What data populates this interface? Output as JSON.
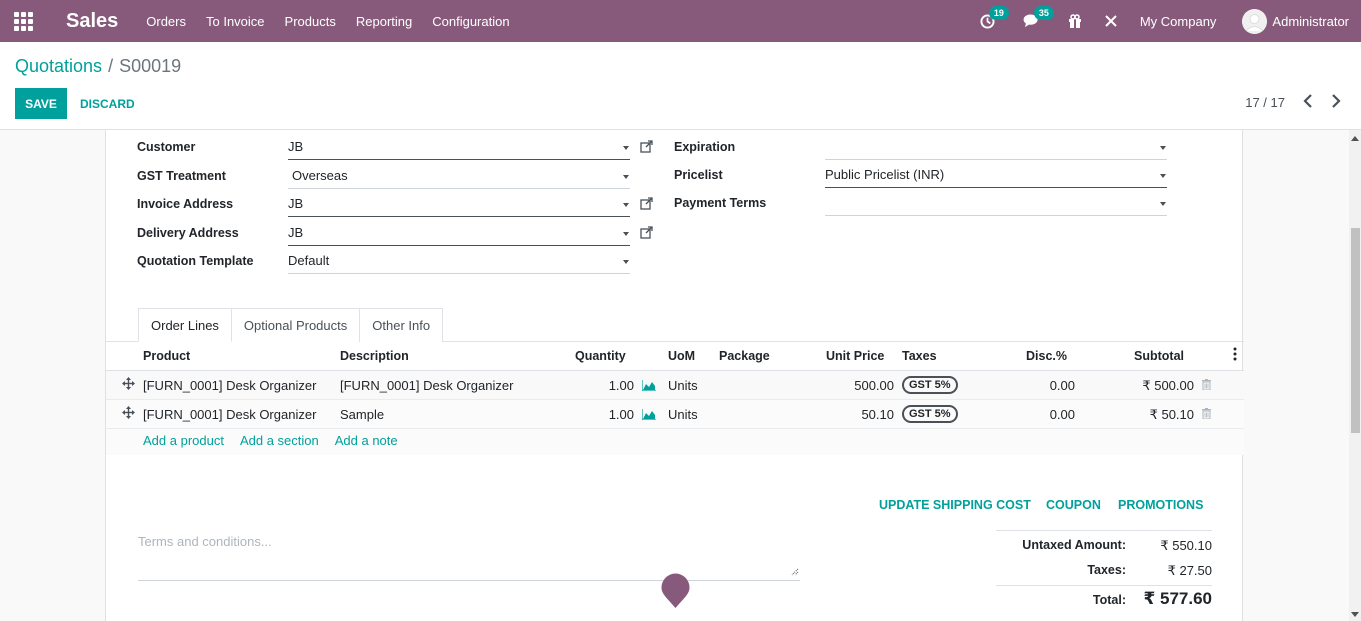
{
  "navbar": {
    "app_name": "Sales",
    "menu": [
      "Orders",
      "To Invoice",
      "Products",
      "Reporting",
      "Configuration"
    ],
    "activity_count": "19",
    "message_count": "35",
    "company": "My Company",
    "user": "Administrator"
  },
  "breadcrumb": {
    "parent": "Quotations",
    "separator": "/",
    "current": "S00019"
  },
  "actions": {
    "save": "SAVE",
    "discard": "DISCARD"
  },
  "pager": {
    "value": "17 / 17"
  },
  "form": {
    "customer_label": "Customer",
    "customer_value": "JB",
    "gst_label": "GST Treatment",
    "gst_value": "Overseas",
    "invoice_address_label": "Invoice Address",
    "invoice_address_value": "JB",
    "delivery_address_label": "Delivery Address",
    "delivery_address_value": "JB",
    "template_label": "Quotation Template",
    "template_value": "Default",
    "expiration_label": "Expiration",
    "expiration_value": "",
    "pricelist_label": "Pricelist",
    "pricelist_value": "Public Pricelist (INR)",
    "payment_terms_label": "Payment Terms",
    "payment_terms_value": ""
  },
  "tabs": [
    "Order Lines",
    "Optional Products",
    "Other Info"
  ],
  "table": {
    "headers": [
      "Product",
      "Description",
      "Quantity",
      "UoM",
      "Package",
      "Unit Price",
      "Taxes",
      "Disc.%",
      "Subtotal"
    ],
    "rows": [
      {
        "product": "[FURN_0001] Desk Organizer",
        "description": "[FURN_0001] Desk Organizer",
        "quantity": "1.00",
        "uom": "Units",
        "package": "",
        "unit_price": "500.00",
        "taxes": "GST 5%",
        "discount": "0.00",
        "subtotal": "₹ 500.00"
      },
      {
        "product": "[FURN_0001] Desk Organizer",
        "description": "Sample",
        "quantity": "1.00",
        "uom": "Units",
        "package": "",
        "unit_price": "50.10",
        "taxes": "GST 5%",
        "discount": "0.00",
        "subtotal": "₹ 50.10"
      }
    ],
    "add_links": [
      "Add a product",
      "Add a section",
      "Add a note"
    ]
  },
  "bottom_actions": [
    "UPDATE SHIPPING COST",
    "COUPON",
    "PROMOTIONS"
  ],
  "terms_placeholder": "Terms and conditions...",
  "totals": {
    "untaxed_label": "Untaxed Amount:",
    "untaxed_value": "₹ 550.10",
    "taxes_label": "Taxes:",
    "taxes_value": "₹ 27.50",
    "total_label": "Total:",
    "total_value": "₹ 577.60"
  },
  "colors": {
    "navbar": "#875a7b",
    "accent": "#00a09d"
  },
  "icons": [
    "apps-icon",
    "clock-icon",
    "chat-icon",
    "gift-icon",
    "debug-icon",
    "external-link-icon",
    "move-handle-icon",
    "forecast-chart-icon",
    "trash-icon",
    "map-pin-icon"
  ]
}
